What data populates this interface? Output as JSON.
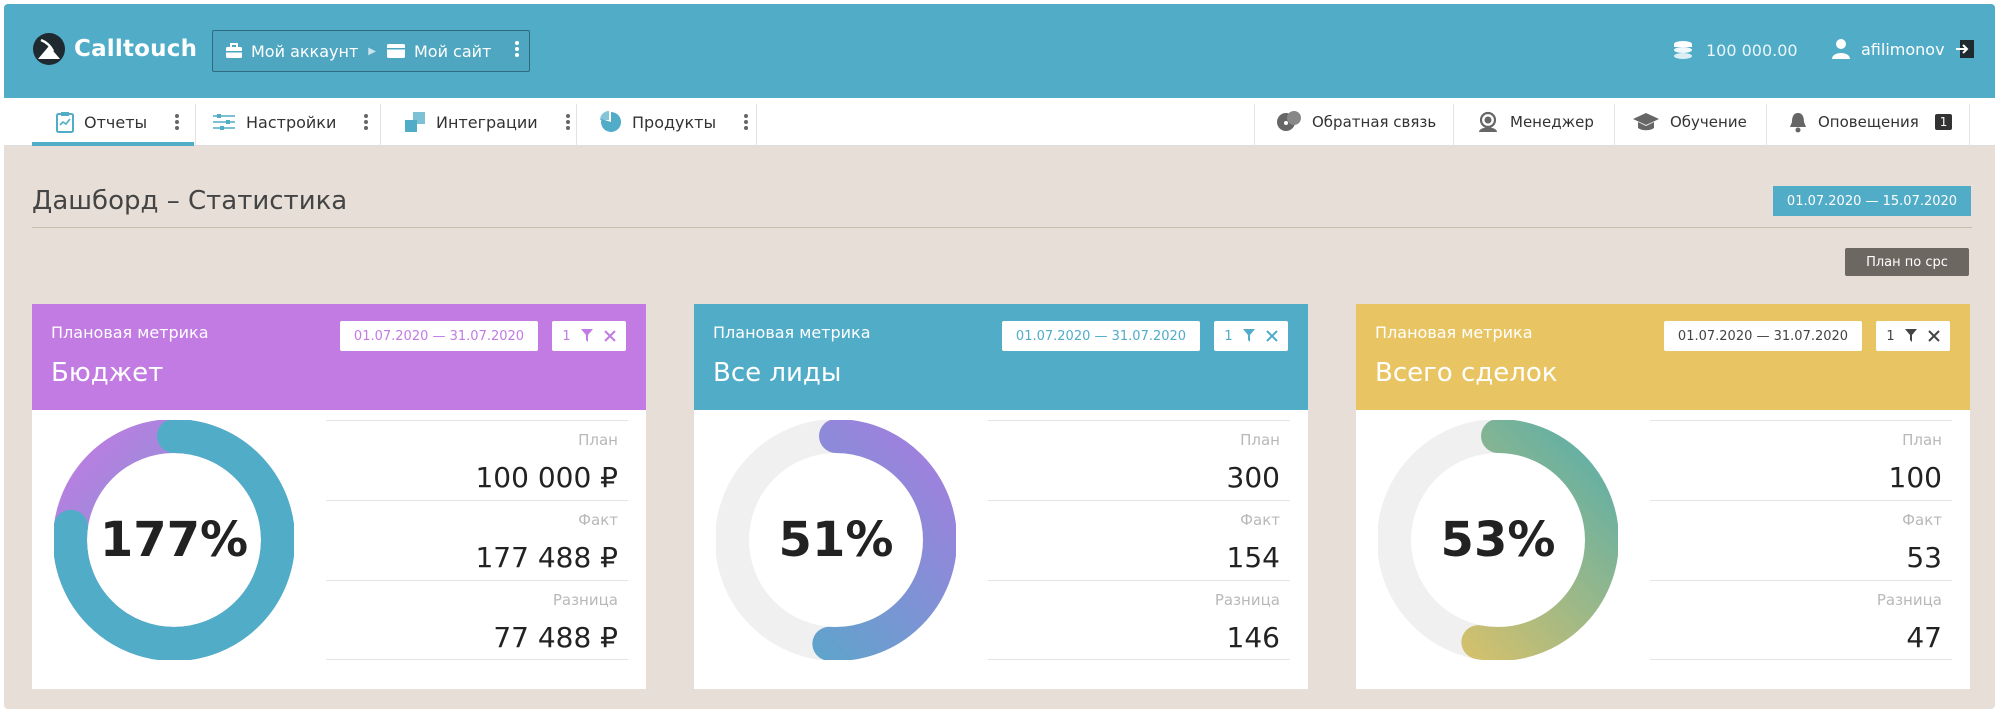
{
  "app": {
    "logo_text": "Calltouch"
  },
  "breadcrumb": {
    "account": "Мой аккаунт",
    "site": "Мой сайт"
  },
  "header": {
    "balance": "100 000.00",
    "username": "afilimonov"
  },
  "nav_left": [
    {
      "label": "Отчеты",
      "icon": "report-icon",
      "active": true
    },
    {
      "label": "Настройки",
      "icon": "sliders-icon"
    },
    {
      "label": "Интеграции",
      "icon": "puzzle-icon"
    },
    {
      "label": "Продукты",
      "icon": "pie-icon"
    }
  ],
  "nav_right": [
    {
      "label": "Обратная связь",
      "icon": "feedback-icon"
    },
    {
      "label": "Менеджер",
      "icon": "manager-icon"
    },
    {
      "label": "Обучение",
      "icon": "graduation-icon"
    },
    {
      "label": "Оповещения",
      "icon": "bell-icon",
      "badge": "1"
    }
  ],
  "page": {
    "title": "Дашборд – Статистика",
    "period": "01.07.2020  —  15.07.2020",
    "plan_button": "План по cpc"
  },
  "cards": [
    {
      "subtitle": "Плановая метрика",
      "title": "Бюджет",
      "date": "01.07.2020  —  31.07.2020",
      "filter_count": "1",
      "percent_label": "177%",
      "progress": 1.77,
      "plan_label": "План",
      "plan_value": "100 000 ₽",
      "fact_label": "Факт",
      "fact_value": "177 488 ₽",
      "diff_label": "Разница",
      "diff_value": "77 488 ₽",
      "head_color": "#c17be3",
      "date_text_color": "#c17be3",
      "grad_from": "#c17be3",
      "grad_to": "#50acc7"
    },
    {
      "subtitle": "Плановая метрика",
      "title": "Все лиды",
      "date": "01.07.2020  —  31.07.2020",
      "filter_count": "1",
      "percent_label": "51%",
      "progress": 0.51,
      "plan_label": "План",
      "plan_value": "300",
      "fact_label": "Факт",
      "fact_value": "154",
      "diff_label": "Разница",
      "diff_value": "146",
      "head_color": "#50acc7",
      "date_text_color": "#50acc7",
      "grad_from": "#50acc7",
      "grad_to": "#a57de0"
    },
    {
      "subtitle": "Плановая метрика",
      "title": "Всего сделок",
      "date": "01.07.2020  —  31.07.2020",
      "filter_count": "1",
      "percent_label": "53%",
      "progress": 0.53,
      "plan_label": "План",
      "plan_value": "100",
      "fact_label": "Факт",
      "fact_value": "53",
      "diff_label": "Разница",
      "diff_value": "47",
      "head_color": "#e9c462",
      "date_text_color": "#444444",
      "grad_from": "#e9c462",
      "grad_to": "#5aaea8"
    }
  ],
  "colors": {
    "accent": "#50acc7",
    "background": "#e7dfd7"
  }
}
